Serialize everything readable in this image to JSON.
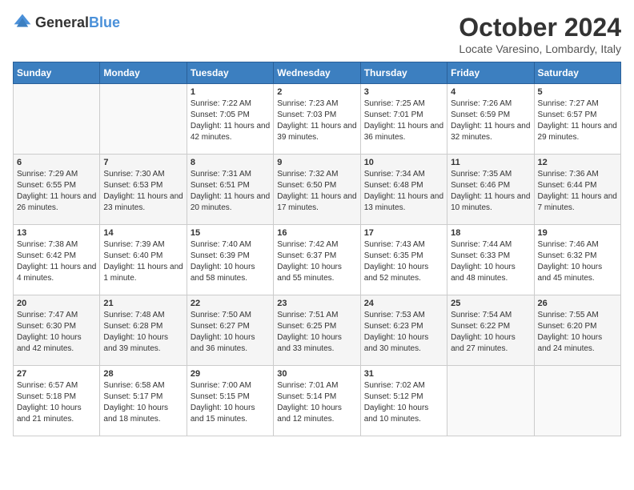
{
  "logo": {
    "general": "General",
    "blue": "Blue"
  },
  "title": "October 2024",
  "location": "Locate Varesino, Lombardy, Italy",
  "weekdays": [
    "Sunday",
    "Monday",
    "Tuesday",
    "Wednesday",
    "Thursday",
    "Friday",
    "Saturday"
  ],
  "weeks": [
    [
      {
        "day": "",
        "sunrise": "",
        "sunset": "",
        "daylight": ""
      },
      {
        "day": "",
        "sunrise": "",
        "sunset": "",
        "daylight": ""
      },
      {
        "day": "1",
        "sunrise": "Sunrise: 7:22 AM",
        "sunset": "Sunset: 7:05 PM",
        "daylight": "Daylight: 11 hours and 42 minutes."
      },
      {
        "day": "2",
        "sunrise": "Sunrise: 7:23 AM",
        "sunset": "Sunset: 7:03 PM",
        "daylight": "Daylight: 11 hours and 39 minutes."
      },
      {
        "day": "3",
        "sunrise": "Sunrise: 7:25 AM",
        "sunset": "Sunset: 7:01 PM",
        "daylight": "Daylight: 11 hours and 36 minutes."
      },
      {
        "day": "4",
        "sunrise": "Sunrise: 7:26 AM",
        "sunset": "Sunset: 6:59 PM",
        "daylight": "Daylight: 11 hours and 32 minutes."
      },
      {
        "day": "5",
        "sunrise": "Sunrise: 7:27 AM",
        "sunset": "Sunset: 6:57 PM",
        "daylight": "Daylight: 11 hours and 29 minutes."
      }
    ],
    [
      {
        "day": "6",
        "sunrise": "Sunrise: 7:29 AM",
        "sunset": "Sunset: 6:55 PM",
        "daylight": "Daylight: 11 hours and 26 minutes."
      },
      {
        "day": "7",
        "sunrise": "Sunrise: 7:30 AM",
        "sunset": "Sunset: 6:53 PM",
        "daylight": "Daylight: 11 hours and 23 minutes."
      },
      {
        "day": "8",
        "sunrise": "Sunrise: 7:31 AM",
        "sunset": "Sunset: 6:51 PM",
        "daylight": "Daylight: 11 hours and 20 minutes."
      },
      {
        "day": "9",
        "sunrise": "Sunrise: 7:32 AM",
        "sunset": "Sunset: 6:50 PM",
        "daylight": "Daylight: 11 hours and 17 minutes."
      },
      {
        "day": "10",
        "sunrise": "Sunrise: 7:34 AM",
        "sunset": "Sunset: 6:48 PM",
        "daylight": "Daylight: 11 hours and 13 minutes."
      },
      {
        "day": "11",
        "sunrise": "Sunrise: 7:35 AM",
        "sunset": "Sunset: 6:46 PM",
        "daylight": "Daylight: 11 hours and 10 minutes."
      },
      {
        "day": "12",
        "sunrise": "Sunrise: 7:36 AM",
        "sunset": "Sunset: 6:44 PM",
        "daylight": "Daylight: 11 hours and 7 minutes."
      }
    ],
    [
      {
        "day": "13",
        "sunrise": "Sunrise: 7:38 AM",
        "sunset": "Sunset: 6:42 PM",
        "daylight": "Daylight: 11 hours and 4 minutes."
      },
      {
        "day": "14",
        "sunrise": "Sunrise: 7:39 AM",
        "sunset": "Sunset: 6:40 PM",
        "daylight": "Daylight: 11 hours and 1 minute."
      },
      {
        "day": "15",
        "sunrise": "Sunrise: 7:40 AM",
        "sunset": "Sunset: 6:39 PM",
        "daylight": "Daylight: 10 hours and 58 minutes."
      },
      {
        "day": "16",
        "sunrise": "Sunrise: 7:42 AM",
        "sunset": "Sunset: 6:37 PM",
        "daylight": "Daylight: 10 hours and 55 minutes."
      },
      {
        "day": "17",
        "sunrise": "Sunrise: 7:43 AM",
        "sunset": "Sunset: 6:35 PM",
        "daylight": "Daylight: 10 hours and 52 minutes."
      },
      {
        "day": "18",
        "sunrise": "Sunrise: 7:44 AM",
        "sunset": "Sunset: 6:33 PM",
        "daylight": "Daylight: 10 hours and 48 minutes."
      },
      {
        "day": "19",
        "sunrise": "Sunrise: 7:46 AM",
        "sunset": "Sunset: 6:32 PM",
        "daylight": "Daylight: 10 hours and 45 minutes."
      }
    ],
    [
      {
        "day": "20",
        "sunrise": "Sunrise: 7:47 AM",
        "sunset": "Sunset: 6:30 PM",
        "daylight": "Daylight: 10 hours and 42 minutes."
      },
      {
        "day": "21",
        "sunrise": "Sunrise: 7:48 AM",
        "sunset": "Sunset: 6:28 PM",
        "daylight": "Daylight: 10 hours and 39 minutes."
      },
      {
        "day": "22",
        "sunrise": "Sunrise: 7:50 AM",
        "sunset": "Sunset: 6:27 PM",
        "daylight": "Daylight: 10 hours and 36 minutes."
      },
      {
        "day": "23",
        "sunrise": "Sunrise: 7:51 AM",
        "sunset": "Sunset: 6:25 PM",
        "daylight": "Daylight: 10 hours and 33 minutes."
      },
      {
        "day": "24",
        "sunrise": "Sunrise: 7:53 AM",
        "sunset": "Sunset: 6:23 PM",
        "daylight": "Daylight: 10 hours and 30 minutes."
      },
      {
        "day": "25",
        "sunrise": "Sunrise: 7:54 AM",
        "sunset": "Sunset: 6:22 PM",
        "daylight": "Daylight: 10 hours and 27 minutes."
      },
      {
        "day": "26",
        "sunrise": "Sunrise: 7:55 AM",
        "sunset": "Sunset: 6:20 PM",
        "daylight": "Daylight: 10 hours and 24 minutes."
      }
    ],
    [
      {
        "day": "27",
        "sunrise": "Sunrise: 6:57 AM",
        "sunset": "Sunset: 5:18 PM",
        "daylight": "Daylight: 10 hours and 21 minutes."
      },
      {
        "day": "28",
        "sunrise": "Sunrise: 6:58 AM",
        "sunset": "Sunset: 5:17 PM",
        "daylight": "Daylight: 10 hours and 18 minutes."
      },
      {
        "day": "29",
        "sunrise": "Sunrise: 7:00 AM",
        "sunset": "Sunset: 5:15 PM",
        "daylight": "Daylight: 10 hours and 15 minutes."
      },
      {
        "day": "30",
        "sunrise": "Sunrise: 7:01 AM",
        "sunset": "Sunset: 5:14 PM",
        "daylight": "Daylight: 10 hours and 12 minutes."
      },
      {
        "day": "31",
        "sunrise": "Sunrise: 7:02 AM",
        "sunset": "Sunset: 5:12 PM",
        "daylight": "Daylight: 10 hours and 10 minutes."
      },
      {
        "day": "",
        "sunrise": "",
        "sunset": "",
        "daylight": ""
      },
      {
        "day": "",
        "sunrise": "",
        "sunset": "",
        "daylight": ""
      }
    ]
  ]
}
